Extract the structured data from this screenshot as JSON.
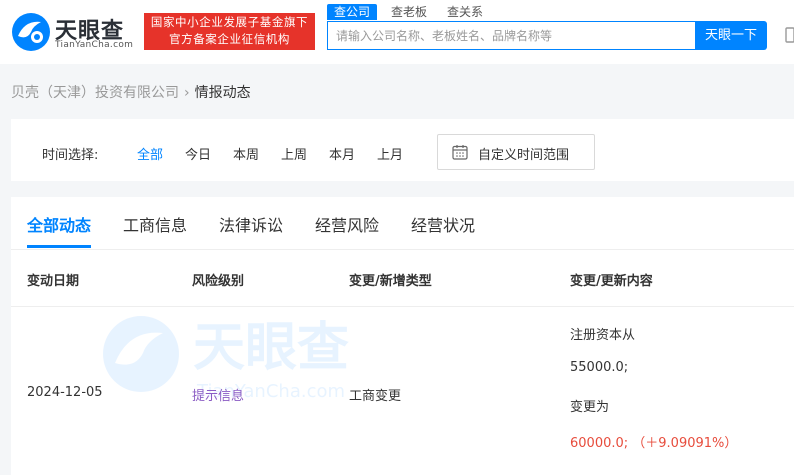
{
  "header": {
    "logo_text": "天眼查",
    "logo_sub": "TianYanCha.com",
    "badge_line1": "国家中小企业发展子基金旗下",
    "badge_line2": "官方备案企业征信机构",
    "search_tabs": [
      "查公司",
      "查老板",
      "查关系"
    ],
    "search_placeholder": "请输入公司名称、老板姓名、品牌名称等",
    "search_button": "天眼一下"
  },
  "breadcrumb": {
    "company": "贝壳（天津）投资有限公司",
    "separator": "›",
    "current": "情报动态"
  },
  "filter": {
    "label": "时间选择:",
    "options": [
      "全部",
      "今日",
      "本周",
      "上周",
      "本月",
      "上月"
    ],
    "selected": "全部",
    "custom_range": "自定义时间范围"
  },
  "tabs": [
    "全部动态",
    "工商信息",
    "法律诉讼",
    "经营风险",
    "经营状况"
  ],
  "active_tab": "全部动态",
  "table": {
    "headers": [
      "变动日期",
      "风险级别",
      "变更/新增类型",
      "变更/更新内容"
    ],
    "rows": [
      {
        "date": "2024-12-05",
        "risk": "提示信息",
        "type": "工商变更",
        "content": [
          "注册资本从",
          "55000.0;",
          "变更为",
          "60000.0; （＋9.09091%）"
        ]
      }
    ]
  },
  "watermark": {
    "text": "天眼查",
    "sub": "TianYanCha.com"
  },
  "colors": {
    "accent": "#0084ff",
    "badge": "#e6332a",
    "risk": "#8b5cc4",
    "increase": "#e74c3c"
  }
}
